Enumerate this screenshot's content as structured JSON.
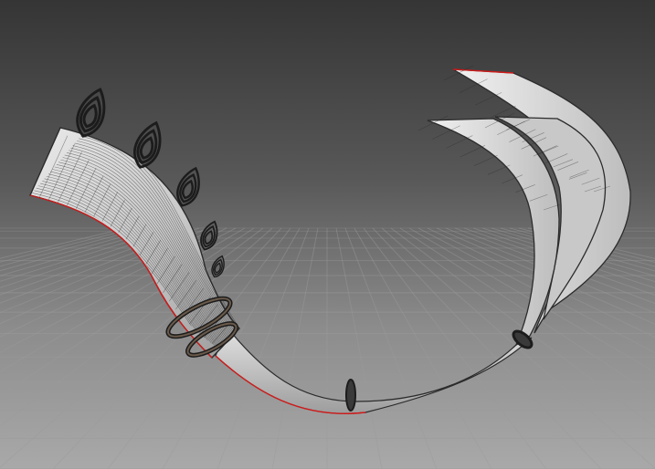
{
  "viewport": {
    "background_top": "#353535",
    "background_bottom": "#a9a9a9",
    "grid_color": "#9c9c9c",
    "wireframe_color": "#2b2b2b",
    "surface_color": "#d6d6d6",
    "highlight_color": "#ffffff",
    "selection_edge_color": "#d21a1a",
    "ornament_color": "#1c1c1c",
    "grid_visible": true
  },
  "model": {
    "subject": "tail-ornament-wireframe",
    "leaf_ornament_count": 5,
    "band_count": 4,
    "spike_count": 3
  }
}
